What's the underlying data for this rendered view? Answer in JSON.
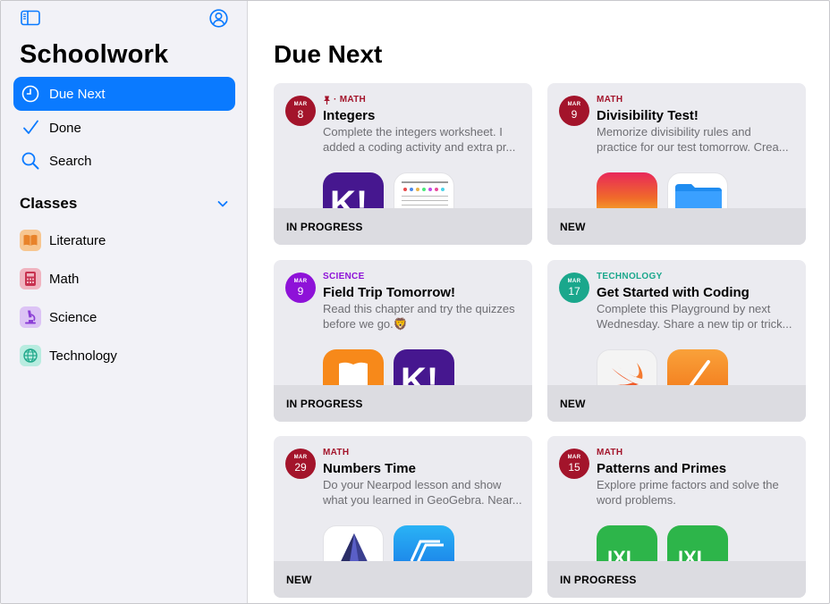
{
  "app": {
    "title": "Schoolwork"
  },
  "colors": {
    "accent": "#0a7aff",
    "sidebar_bg": "#f2f2f7",
    "card_bg": "#ebebf0",
    "math": "#a3142b",
    "science": "#8e12d8",
    "technology": "#1aa78c"
  },
  "sidebar": {
    "toggle_icon": "sidebar-icon",
    "account_icon": "person-circle-icon",
    "nav": [
      {
        "label": "Due Next",
        "icon": "clock-icon",
        "active": true
      },
      {
        "label": "Done",
        "icon": "checkmark-icon",
        "active": false
      },
      {
        "label": "Search",
        "icon": "magnifying-glass-icon",
        "active": false
      }
    ],
    "classes_heading": "Classes",
    "classes": [
      {
        "label": "Literature",
        "icon": "book-icon",
        "color": "#f0a24a"
      },
      {
        "label": "Math",
        "icon": "calculator-icon",
        "color": "#d1506a"
      },
      {
        "label": "Science",
        "icon": "microscope-icon",
        "color": "#a463e0"
      },
      {
        "label": "Technology",
        "icon": "globe-icon",
        "color": "#3cc2a6"
      }
    ]
  },
  "main": {
    "title": "Due Next",
    "cards": [
      {
        "month": "MAR",
        "day": "8",
        "category": "· MATH",
        "pinned": true,
        "title": "Integers",
        "desc1": "Complete the integers worksheet. I",
        "desc2": "added a coding activity and extra pr...",
        "status": "IN PROGRESS",
        "apps": [
          "kahoot-app-icon",
          "worksheet-thumbnail"
        ]
      },
      {
        "month": "MAR",
        "day": "9",
        "category": "MATH",
        "pinned": false,
        "title": "Divisibility Test!",
        "desc1": "Memorize divisibility rules and",
        "desc2": "practice for our test tomorrow. Crea...",
        "status": "NEW",
        "apps": [
          "quiz-app-icon",
          "files-app-icon"
        ]
      },
      {
        "month": "MAR",
        "day": "9",
        "category": "SCIENCE",
        "pinned": false,
        "title": "Field Trip Tomorrow!",
        "desc1": "Read this chapter and try the quizzes",
        "desc2": "before we go.🦁",
        "status": "IN PROGRESS",
        "apps": [
          "books-app-icon",
          "kahoot-app-icon"
        ]
      },
      {
        "month": "MAR",
        "day": "17",
        "category": "TECHNOLOGY",
        "pinned": false,
        "title": "Get Started with Coding",
        "desc1": "Complete this Playground by next",
        "desc2": "Wednesday. Share a new tip or trick...",
        "status": "NEW",
        "apps": [
          "swift-playgrounds-app-icon",
          "pages-app-icon"
        ]
      },
      {
        "month": "MAR",
        "day": "29",
        "category": "MATH",
        "pinned": false,
        "title": "Numbers Time",
        "desc1": "Do your Nearpod lesson and show",
        "desc2": "what you learned in GeoGebra. Near...",
        "status": "NEW",
        "apps": [
          "geogebra-app-icon",
          "nearpod-app-icon"
        ]
      },
      {
        "month": "MAR",
        "day": "15",
        "category": "MATH",
        "pinned": false,
        "title": "Patterns and Primes",
        "desc1": "Explore prime factors and solve the",
        "desc2": "word problems.",
        "status": "IN PROGRESS",
        "apps": [
          "ixl-app-icon",
          "ixl-app-icon"
        ]
      }
    ]
  }
}
